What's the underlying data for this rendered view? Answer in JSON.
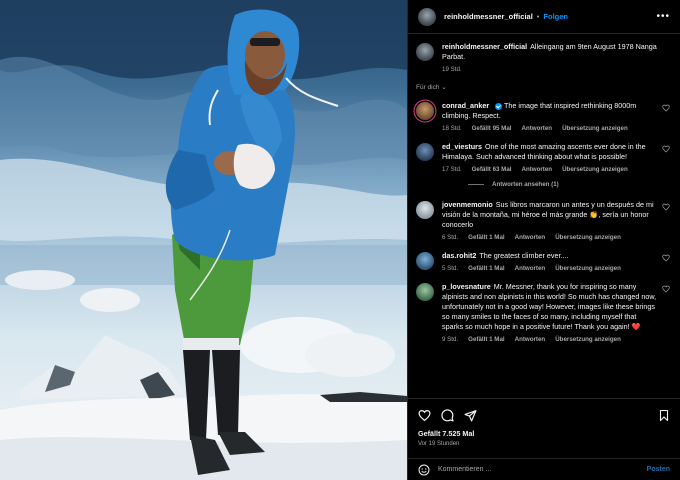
{
  "post": {
    "username": "reinholdmessner_official",
    "follow_label": "Folgen",
    "caption_text": "Alleingang am 9ten August 1978 Nanga Parbat.",
    "caption_time": "19 Std.",
    "for_you_label": "Für dich",
    "likes_label": "Gefällt 7.525 Mal",
    "time_ago": "Vor 19 Stunden",
    "comment_placeholder": "Kommentieren ...",
    "post_label": "Posten"
  },
  "comments": [
    {
      "user": "conrad_anker",
      "verified": true,
      "text": "The image that inspired rethinking 8000m climbing. Respect.",
      "time": "18 Std.",
      "likes": "Gefällt 95 Mal",
      "reply": "Antworten",
      "translate": "Übersetzung anzeigen"
    },
    {
      "user": "ed_viesturs",
      "text": "One of the most amazing ascents ever done in the Himalaya. Such advanced thinking about what is possible!",
      "time": "17 Std.",
      "likes": "Gefällt 63 Mal",
      "reply": "Antworten",
      "translate": "Übersetzung anzeigen",
      "view_replies": "Antworten ansehen (1)"
    },
    {
      "user": "jovenmemonio",
      "text": "Sus libros marcaron un antes y un después de mi visión de la montaña, mi héroe el más grande 👏, sería un honor conocerlo",
      "time": "6 Std.",
      "likes": "Gefällt 1 Mal",
      "reply": "Antworten",
      "translate": "Übersetzung anzeigen"
    },
    {
      "user": "das.rohit2",
      "text": "The greatest climber ever....",
      "time": "5 Std.",
      "likes": "Gefällt 1 Mal",
      "reply": "Antworten",
      "translate": "Übersetzung anzeigen"
    },
    {
      "user": "p_lovesnature",
      "text": "Mr. Messner, thank you for inspiring so many alpinists and non alpinists in this world! So much has changed now, unfortunately not in a good way! However, images like these brings so many smiles to the faces of so many, including myself that sparks so much hope in a positive future! Thank you again! ❤️",
      "time": "9 Std.",
      "likes": "Gefällt 1 Mal",
      "reply": "Antworten",
      "translate": "Übersetzung anzeigen"
    }
  ],
  "colors": {
    "follow_blue": "#0095f6",
    "background": "#000000",
    "muted_text": "#a8a8a8"
  },
  "icons": [
    "more-icon",
    "heart-icon",
    "comment-icon",
    "share-icon",
    "bookmark-icon",
    "emoji-icon",
    "chevron-down-icon",
    "verified-icon"
  ]
}
